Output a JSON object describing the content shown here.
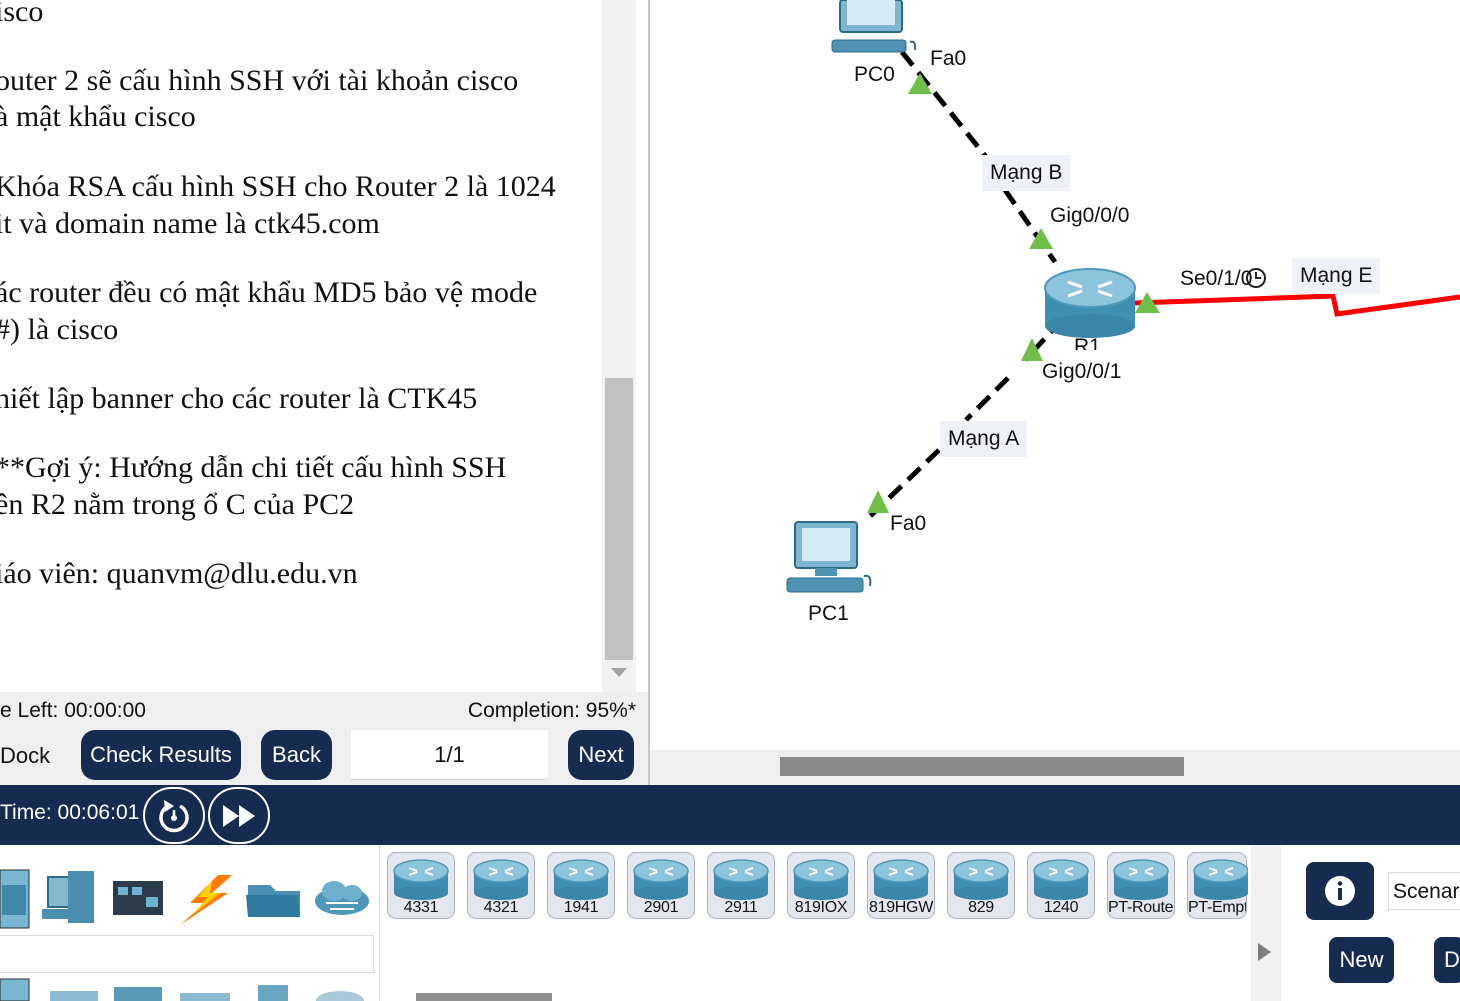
{
  "instructions": {
    "lines": [
      "isco",
      "outer 2 sẽ cấu hình SSH với tài khoản cisco",
      "à mật khẩu cisco",
      "Khóa RSA cấu hình SSH cho Router 2 là 1024",
      "it và domain name là ctk45.com",
      "ác router đều có mật khẩu MD5 bảo vệ mode",
      "#) là cisco",
      "hiết lập banner cho các router là CTK45",
      "**Gợi ý: Hướng dẫn chi tiết cấu hình SSH",
      "ên R2 nằm trong ổ C của PC2",
      "iáo viên: quanvm@dlu.edu.vn"
    ],
    "time_left": "e Left: 00:00:00",
    "completion": "Completion: 95%*",
    "dock_label": "Dock",
    "check_results": "Check Results",
    "back": "Back",
    "page": "1/1",
    "next": "Next"
  },
  "topology": {
    "pc0": "PC0",
    "pc1": "PC1",
    "router": "R1",
    "pc0_port": "Fa0",
    "pc1_port": "Fa0",
    "r1_port_top": "Gig0/0/0",
    "r1_port_bottom": "Gig0/0/1",
    "r1_port_serial": "Se0/1/0",
    "net_b": "Mạng B",
    "net_a": "Mạng A",
    "net_e": "Mạng E",
    "colors": {
      "copper_link": "#000000",
      "serial_link": "#ff0000",
      "link_up": "#6fbf4a"
    }
  },
  "bottom_bar": {
    "sim_time": "Time: 00:06:01",
    "reset_icon": "reset-time-icon",
    "fast_forward_icon": "fast-forward-icon"
  },
  "device_palette": {
    "categories": [
      "network-devices-icon",
      "end-devices-icon",
      "components-icon",
      "connections-icon",
      "miscellaneous-icon",
      "multiuser-icon"
    ],
    "routers": [
      "4331",
      "4321",
      "1941",
      "2901",
      "2911",
      "819IOX",
      "819HGW",
      "829",
      "1240",
      "PT-Router",
      "PT-Empt"
    ]
  },
  "scenario": {
    "field": "Scenar",
    "new": "New",
    "delete": "D"
  }
}
